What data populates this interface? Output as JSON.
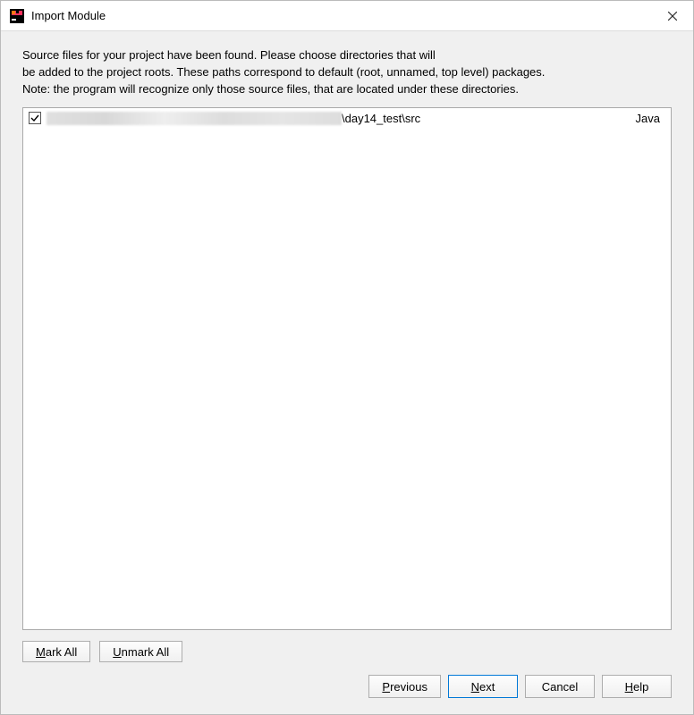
{
  "window": {
    "title": "Import Module"
  },
  "description": {
    "line1": "Source files for your project have been found. Please choose directories that will",
    "line2": "be added to the project roots. These paths correspond to default (root, unnamed, top level) packages.",
    "line3": "Note: the program will recognize only those source files, that are located under these directories."
  },
  "sources": [
    {
      "checked": true,
      "path_visible": "\\day14_test\\src",
      "language": "Java"
    }
  ],
  "buttons": {
    "mark_all": "Mark All",
    "unmark_all": "Unmark All",
    "previous": "Previous",
    "next": "Next",
    "cancel": "Cancel",
    "help": "Help"
  }
}
